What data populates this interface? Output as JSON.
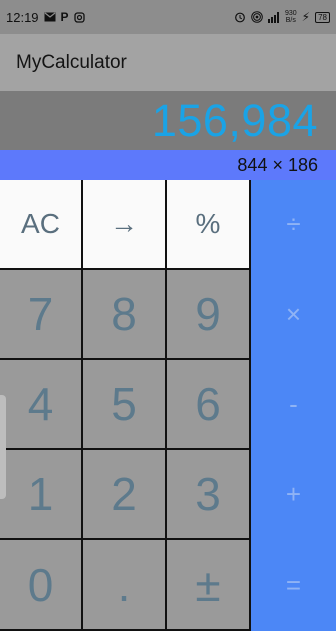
{
  "status_bar": {
    "time": "12:19",
    "net_speed_value": "930",
    "net_speed_unit": "B/s",
    "battery": "78",
    "left_icons": [
      "mail-icon",
      "parking-icon",
      "instagram-icon"
    ],
    "right_icons": [
      "alarm-icon",
      "hotspot-icon",
      "signal-icon",
      "charging-icon"
    ]
  },
  "app_bar": {
    "title": "MyCalculator"
  },
  "display": {
    "result": "156,984"
  },
  "expression": {
    "text": "844 × 186"
  },
  "keys": {
    "row1": [
      "AC",
      "→",
      "%",
      "÷"
    ],
    "row2": [
      "7",
      "8",
      "9",
      "×"
    ],
    "row3": [
      "4",
      "5",
      "6",
      "-"
    ],
    "row4": [
      "1",
      "2",
      "3",
      "+"
    ],
    "row5": [
      "0",
      ".",
      "±",
      "="
    ]
  },
  "colors": {
    "display_text": "#1aa3e6",
    "expression_bg": "#5d79fb",
    "operator_bg": "#4c87f6",
    "function_bg": "#fafafa",
    "number_bg": "#9a9a9a"
  }
}
